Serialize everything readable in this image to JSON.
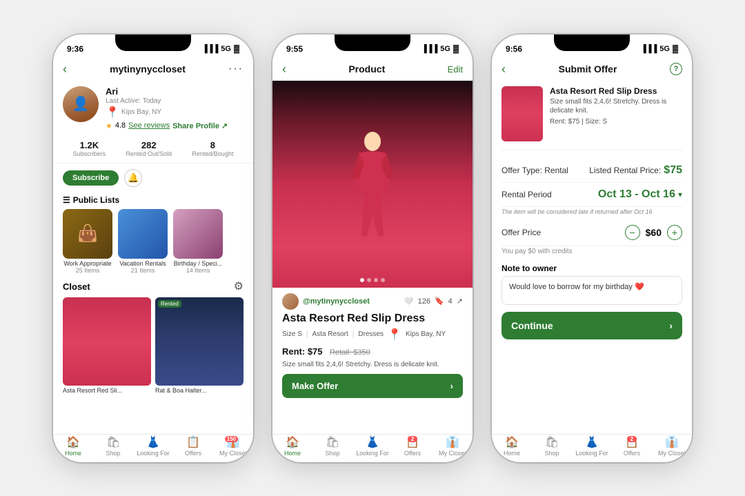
{
  "background": "#f0f0f0",
  "phones": {
    "phone1": {
      "status": {
        "time": "9:36",
        "signal": "5G",
        "battery": "100"
      },
      "nav": {
        "back": "‹",
        "title": "mytinynyccloset",
        "menu": "···"
      },
      "profile": {
        "name": "Ari",
        "active": "Last Active: Today",
        "location": "Kips Bay, NY",
        "rating": "4.8",
        "reviews": "See reviews",
        "share": "Share Profile ↗"
      },
      "stats": [
        {
          "num": "1.2K",
          "label": "Subscribers"
        },
        {
          "num": "282",
          "label": "Rented Out/Sold"
        },
        {
          "num": "8",
          "label": "Rented/Bought"
        }
      ],
      "actions": {
        "subscribe": "Subscribe",
        "bell": "🔔"
      },
      "public_lists": {
        "title": "Public Lists",
        "items": [
          {
            "label": "Work Appropriate",
            "count": "25 Items"
          },
          {
            "label": "Vacation Rentals",
            "count": "21 Items"
          },
          {
            "label": "Birthday / Speci...",
            "count": "14 Items"
          }
        ]
      },
      "closet": {
        "title": "Closet",
        "items": [
          {
            "label": "Asta Resort Red Sli...",
            "rented": false
          },
          {
            "label": "Rat & Boa Halter...",
            "rented": true
          }
        ]
      },
      "tabs": [
        {
          "icon": "🏠",
          "label": "Home",
          "active": true
        },
        {
          "icon": "🛍",
          "label": "Shop"
        },
        {
          "icon": "👗",
          "label": "Looking For"
        },
        {
          "icon": "📋",
          "label": "Offers"
        },
        {
          "icon": "👔",
          "label": "My Closet",
          "badge": "150"
        }
      ]
    },
    "phone2": {
      "status": {
        "time": "9:55",
        "signal": "5G",
        "battery": "100"
      },
      "nav": {
        "back": "‹",
        "title": "Product",
        "edit": "Edit"
      },
      "product": {
        "username": "@mytinynyccloset",
        "likes": "126",
        "bookmarks": "4",
        "title": "Asta Resort Red Slip Dress",
        "size": "Size S",
        "brand": "Asta Resort",
        "category": "Dresses",
        "location": "Kips Bay, NY",
        "rent": "Rent: $75",
        "retail": "Retail: $350",
        "desc": "Size small fits 2,4,6! Stretchy. Dress is delicate knit.",
        "make_offer": "Make Offer"
      },
      "tabs": [
        {
          "icon": "🏠",
          "label": "Home",
          "active": true
        },
        {
          "icon": "🛍",
          "label": "Shop"
        },
        {
          "icon": "👗",
          "label": "Looking For"
        },
        {
          "icon": "📋",
          "label": "Offers",
          "badge": "2"
        },
        {
          "icon": "👔",
          "label": "My Closet"
        }
      ]
    },
    "phone3": {
      "status": {
        "time": "9:56",
        "signal": "5G",
        "battery": "100"
      },
      "nav": {
        "back": "‹",
        "title": "Submit Offer",
        "help": "?"
      },
      "offer": {
        "product_name": "Asta Resort Red Slip Dress",
        "product_desc": "Size small fits 2,4,6! Stretchy. Dress is delicate knit.",
        "product_price": "Rent: $75 | Size: S",
        "offer_type_label": "Offer Type: Rental",
        "listed_price_label": "Listed Rental Price:",
        "listed_price": "$75",
        "rental_period_label": "Rental Period",
        "rental_period": "Oct 13 - Oct 16",
        "late_note": "The item will be considered late if returned after Oct 16",
        "offer_price_label": "Offer Price",
        "offer_price": "$60",
        "credits_note": "You pay $0 with credits",
        "note_label": "Note to owner",
        "note_value": "Would love to borrow for my birthday ❤️",
        "continue_btn": "Continue"
      },
      "tabs": [
        {
          "icon": "🏠",
          "label": "Home"
        },
        {
          "icon": "🛍",
          "label": "Shop"
        },
        {
          "icon": "👗",
          "label": "Looking For"
        },
        {
          "icon": "📋",
          "label": "Offers",
          "badge": "2"
        },
        {
          "icon": "👔",
          "label": "My Closet"
        }
      ]
    }
  }
}
